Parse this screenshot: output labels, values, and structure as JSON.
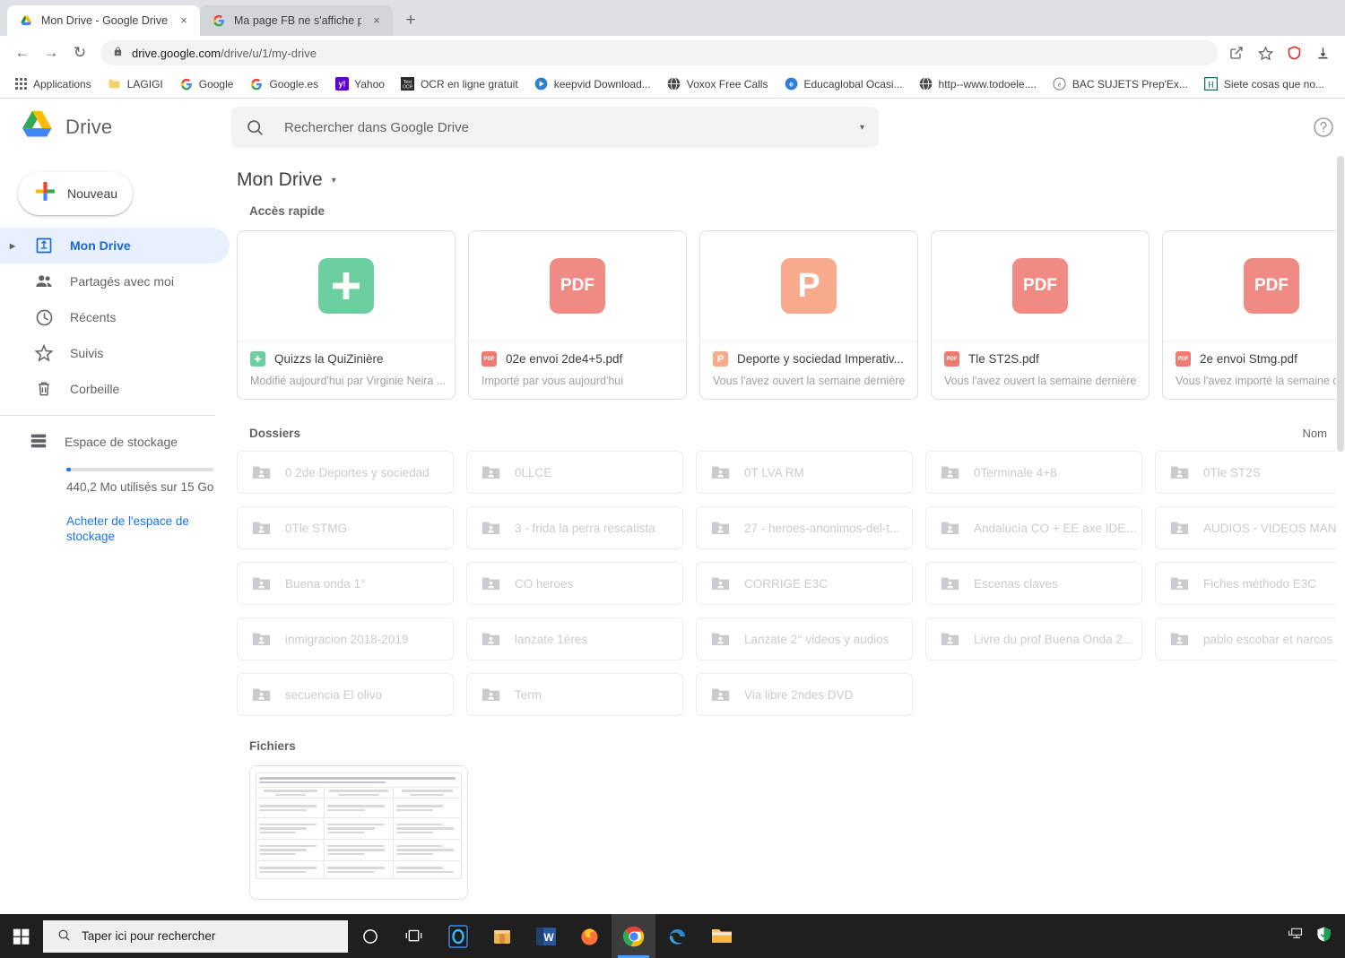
{
  "browser": {
    "tabs": [
      {
        "title": "Mon Drive - Google Drive",
        "favicon": "drive-icon",
        "active": true,
        "close": "×"
      },
      {
        "title": "Ma page FB ne s'affiche plus cor",
        "favicon": "google-icon",
        "active": false,
        "close": "×"
      }
    ],
    "new_tab_label": "+",
    "nav": {
      "back": "←",
      "forward": "→",
      "reload": "↻"
    },
    "omnibox": {
      "lock": "🔒",
      "url_domain": "drive.google.com",
      "url_path": "/drive/u/1/my-drive"
    },
    "toolbar_icons": [
      "share-icon",
      "bookmark-star-icon",
      "adblock-shield-icon",
      "download-icon"
    ],
    "bookmarks": [
      {
        "label": "Applications",
        "icon": "apps-grid-icon"
      },
      {
        "label": "LAGIGI",
        "icon": "folder-icon"
      },
      {
        "label": "Google",
        "icon": "google-g-icon"
      },
      {
        "label": "Google.es",
        "icon": "google-g-icon"
      },
      {
        "label": "Yahoo",
        "icon": "yahoo-icon"
      },
      {
        "label": "OCR en ligne gratuit",
        "icon": "ocr-icon"
      },
      {
        "label": "keepvid Download...",
        "icon": "keepvid-icon"
      },
      {
        "label": "Voxox Free Calls",
        "icon": "globe-icon"
      },
      {
        "label": "Educaglobal  Ocasi...",
        "icon": "educaglobal-icon"
      },
      {
        "label": "http--www.todoele....",
        "icon": "globe-icon"
      },
      {
        "label": "BAC SUJETS Prep'Ex...",
        "icon": "bac-icon"
      },
      {
        "label": "Siete cosas que no...",
        "icon": "h-icon"
      }
    ]
  },
  "drive": {
    "logo_text": "Drive",
    "search": {
      "placeholder": "Rechercher dans Google Drive",
      "icon": "search-icon",
      "caret": "▾"
    },
    "help_icon": "help-circle-icon",
    "new_button": {
      "label": "Nouveau",
      "icon": "plus-icon"
    },
    "nav_items": [
      {
        "label": "Mon Drive",
        "icon": "my-drive-icon",
        "active": true,
        "expandable": true
      },
      {
        "label": "Partagés avec moi",
        "icon": "people-icon",
        "active": false,
        "expandable": false
      },
      {
        "label": "Récents",
        "icon": "clock-icon",
        "active": false,
        "expandable": false
      },
      {
        "label": "Suivis",
        "icon": "star-icon",
        "active": false,
        "expandable": false
      },
      {
        "label": "Corbeille",
        "icon": "trash-icon",
        "active": false,
        "expandable": false
      }
    ],
    "storage": {
      "label": "Espace de stockage",
      "icon": "storage-icon",
      "usage_text": "440,2 Mo utilisés sur 15 Go",
      "percent": 2.9,
      "buy_link": "Acheter de l'espace de stockage"
    },
    "breadcrumb": {
      "title": "Mon Drive",
      "caret": "▾"
    },
    "quick_access": {
      "title": "Accès rapide",
      "items": [
        {
          "name": "Quizzs la QuiZinière",
          "sub": "Modifié aujourd'hui par Virginie Neira ...",
          "icon_type": "sheets",
          "icon_glyph": "✚",
          "icon_color": "#6dcfa0"
        },
        {
          "name": "02e envoi 2de4+5.pdf",
          "sub": "Importé par vous aujourd'hui",
          "icon_type": "pdf",
          "icon_glyph": "PDF",
          "icon_color": "#f08a84"
        },
        {
          "name": "Deporte y sociedad Imperativ...",
          "sub": "Vous l'avez ouvert la semaine dernière",
          "icon_type": "slides",
          "icon_glyph": "P",
          "icon_color": "#f7ab8c"
        },
        {
          "name": "Tle ST2S.pdf",
          "sub": "Vous l'avez ouvert la semaine dernière",
          "icon_type": "pdf",
          "icon_glyph": "PDF",
          "icon_color": "#f08a84"
        },
        {
          "name": "2e envoi Stmg.pdf",
          "sub": "Vous l'avez importé la semaine der",
          "icon_type": "pdf",
          "icon_glyph": "PDF",
          "icon_color": "#f08a84"
        }
      ]
    },
    "folders": {
      "title": "Dossiers",
      "column_header": "Nom",
      "items": [
        "0 2de Deportes y sociedad",
        "0LLCE",
        "0T LVA RM",
        "0Terminale 4+8",
        "0Tle ST2S",
        "0Tle STMG",
        "3 - frida la perra rescatista",
        "27 - heroes-anonimos-del-t...",
        "Andalucía CO + EE axe IDEN...",
        "AUDIOS - VIDEOS MANUE",
        "Buena onda 1°",
        "CO heroes",
        "CORRIGE E3C",
        "Escenas claves",
        "Fiches méthodo E3C",
        "inmigracion 2018-2019",
        "lanzate 1ères",
        "Lanzate 2° videos y audios",
        "Livre du prof Buena Onda 2...",
        "pablo escobar et narcos",
        "secuencia El olivo",
        "Term",
        "Via libre 2ndes DVD"
      ]
    },
    "files": {
      "title": "Fichiers"
    }
  },
  "taskbar": {
    "start_icon": "windows-icon",
    "search_placeholder": "Taper ici pour rechercher",
    "search_icon": "search-icon",
    "apps": [
      {
        "name": "cortana-icon",
        "active": false
      },
      {
        "name": "task-view-icon",
        "active": false
      },
      {
        "name": "cortana-app-icon",
        "active": false
      },
      {
        "name": "store-icon",
        "active": false
      },
      {
        "name": "word-icon",
        "active": false
      },
      {
        "name": "firefox-icon",
        "active": false
      },
      {
        "name": "chrome-icon",
        "active": true
      },
      {
        "name": "edge-icon",
        "active": false
      },
      {
        "name": "file-explorer-icon",
        "active": false
      }
    ],
    "tray": [
      "network-icon",
      "security-icon"
    ]
  }
}
